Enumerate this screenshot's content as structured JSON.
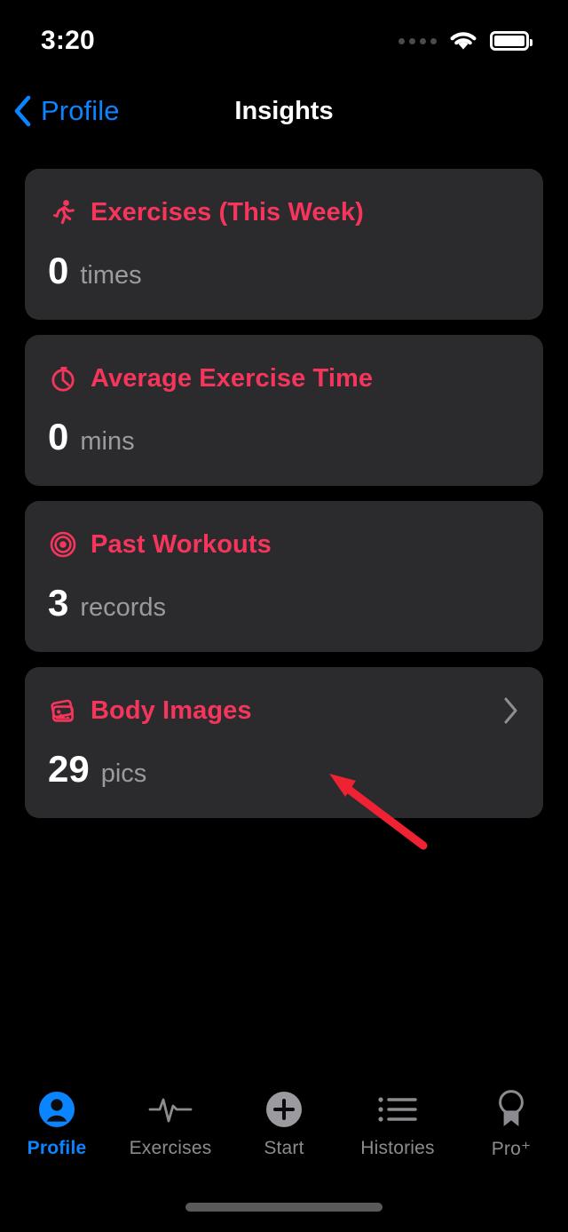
{
  "status_bar": {
    "time": "3:20",
    "signal_icon": "signal-dots-icon",
    "wifi_icon": "wifi-icon",
    "battery_icon": "battery-full-icon"
  },
  "nav": {
    "back_icon": "chevron-left-icon",
    "back_label": "Profile",
    "title": "Insights"
  },
  "colors": {
    "accent": "#F6355C",
    "background": "#000000",
    "card": "#2B2B2D",
    "link": "#0A84FF",
    "muted": "#9B9B9F",
    "annotation_arrow": "#EE2233"
  },
  "cards": [
    {
      "icon": "running-person-icon",
      "title": "Exercises (This Week)",
      "value": "0",
      "unit": "times",
      "has_chevron": false
    },
    {
      "icon": "stopwatch-icon",
      "title": "Average Exercise Time",
      "value": "0",
      "unit": "mins",
      "has_chevron": false
    },
    {
      "icon": "target-icon",
      "title": "Past Workouts",
      "value": "3",
      "unit": "records",
      "has_chevron": false
    },
    {
      "icon": "photos-icon",
      "title": "Body Images",
      "value": "29",
      "unit": "pics",
      "has_chevron": true,
      "chevron_icon": "chevron-right-icon"
    }
  ],
  "annotation": {
    "type": "arrow",
    "points_to": "body-images-card"
  },
  "tabbar": {
    "items": [
      {
        "label": "Profile",
        "icon": "person-circle-icon",
        "active": true
      },
      {
        "label": "Exercises",
        "icon": "pulse-waveform-icon",
        "active": false
      },
      {
        "label": "Start",
        "icon": "plus-circle-icon",
        "active": false
      },
      {
        "label": "Histories",
        "icon": "list-bullet-icon",
        "active": false
      },
      {
        "label": "Pro⁺",
        "icon": "award-ribbon-icon",
        "active": false
      }
    ]
  }
}
